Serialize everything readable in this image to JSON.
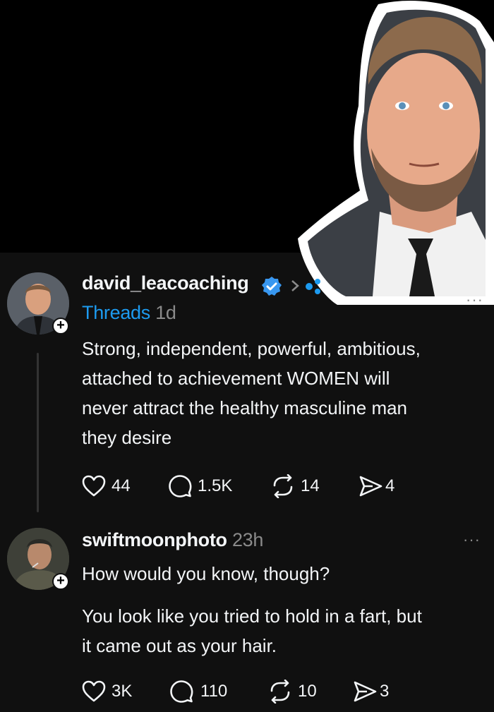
{
  "colors": {
    "background": "#000000",
    "feed_bg": "#101010",
    "link": "#1d9bf0",
    "muted": "#8a8a8a",
    "text": "#f3f5f7",
    "verified": "#3897f0"
  },
  "post1": {
    "username": "david_leacoaching",
    "crosspost_label": "Threads",
    "time": "1d",
    "lines": [
      "Strong, independent, powerful, ambitious,",
      "attached to achievement WOMEN will",
      "never attract the healthy masculine man",
      "they desire"
    ],
    "likes": "44",
    "replies": "1.5K",
    "reposts": "14",
    "shares": "4",
    "more": "···"
  },
  "post2": {
    "username": "swiftmoonphoto",
    "time": "23h",
    "line1": "How would you know, though?",
    "lines": [
      "You look like you tried to hold in a fart, but",
      "it came out as your hair."
    ],
    "likes": "3K",
    "replies": "110",
    "reposts": "10",
    "shares": "3",
    "more": "···"
  },
  "icons": [
    "verified-icon",
    "chevron-right-icon",
    "heart-icon",
    "comment-icon",
    "repost-icon",
    "share-icon",
    "plus-icon",
    "more-icon"
  ]
}
